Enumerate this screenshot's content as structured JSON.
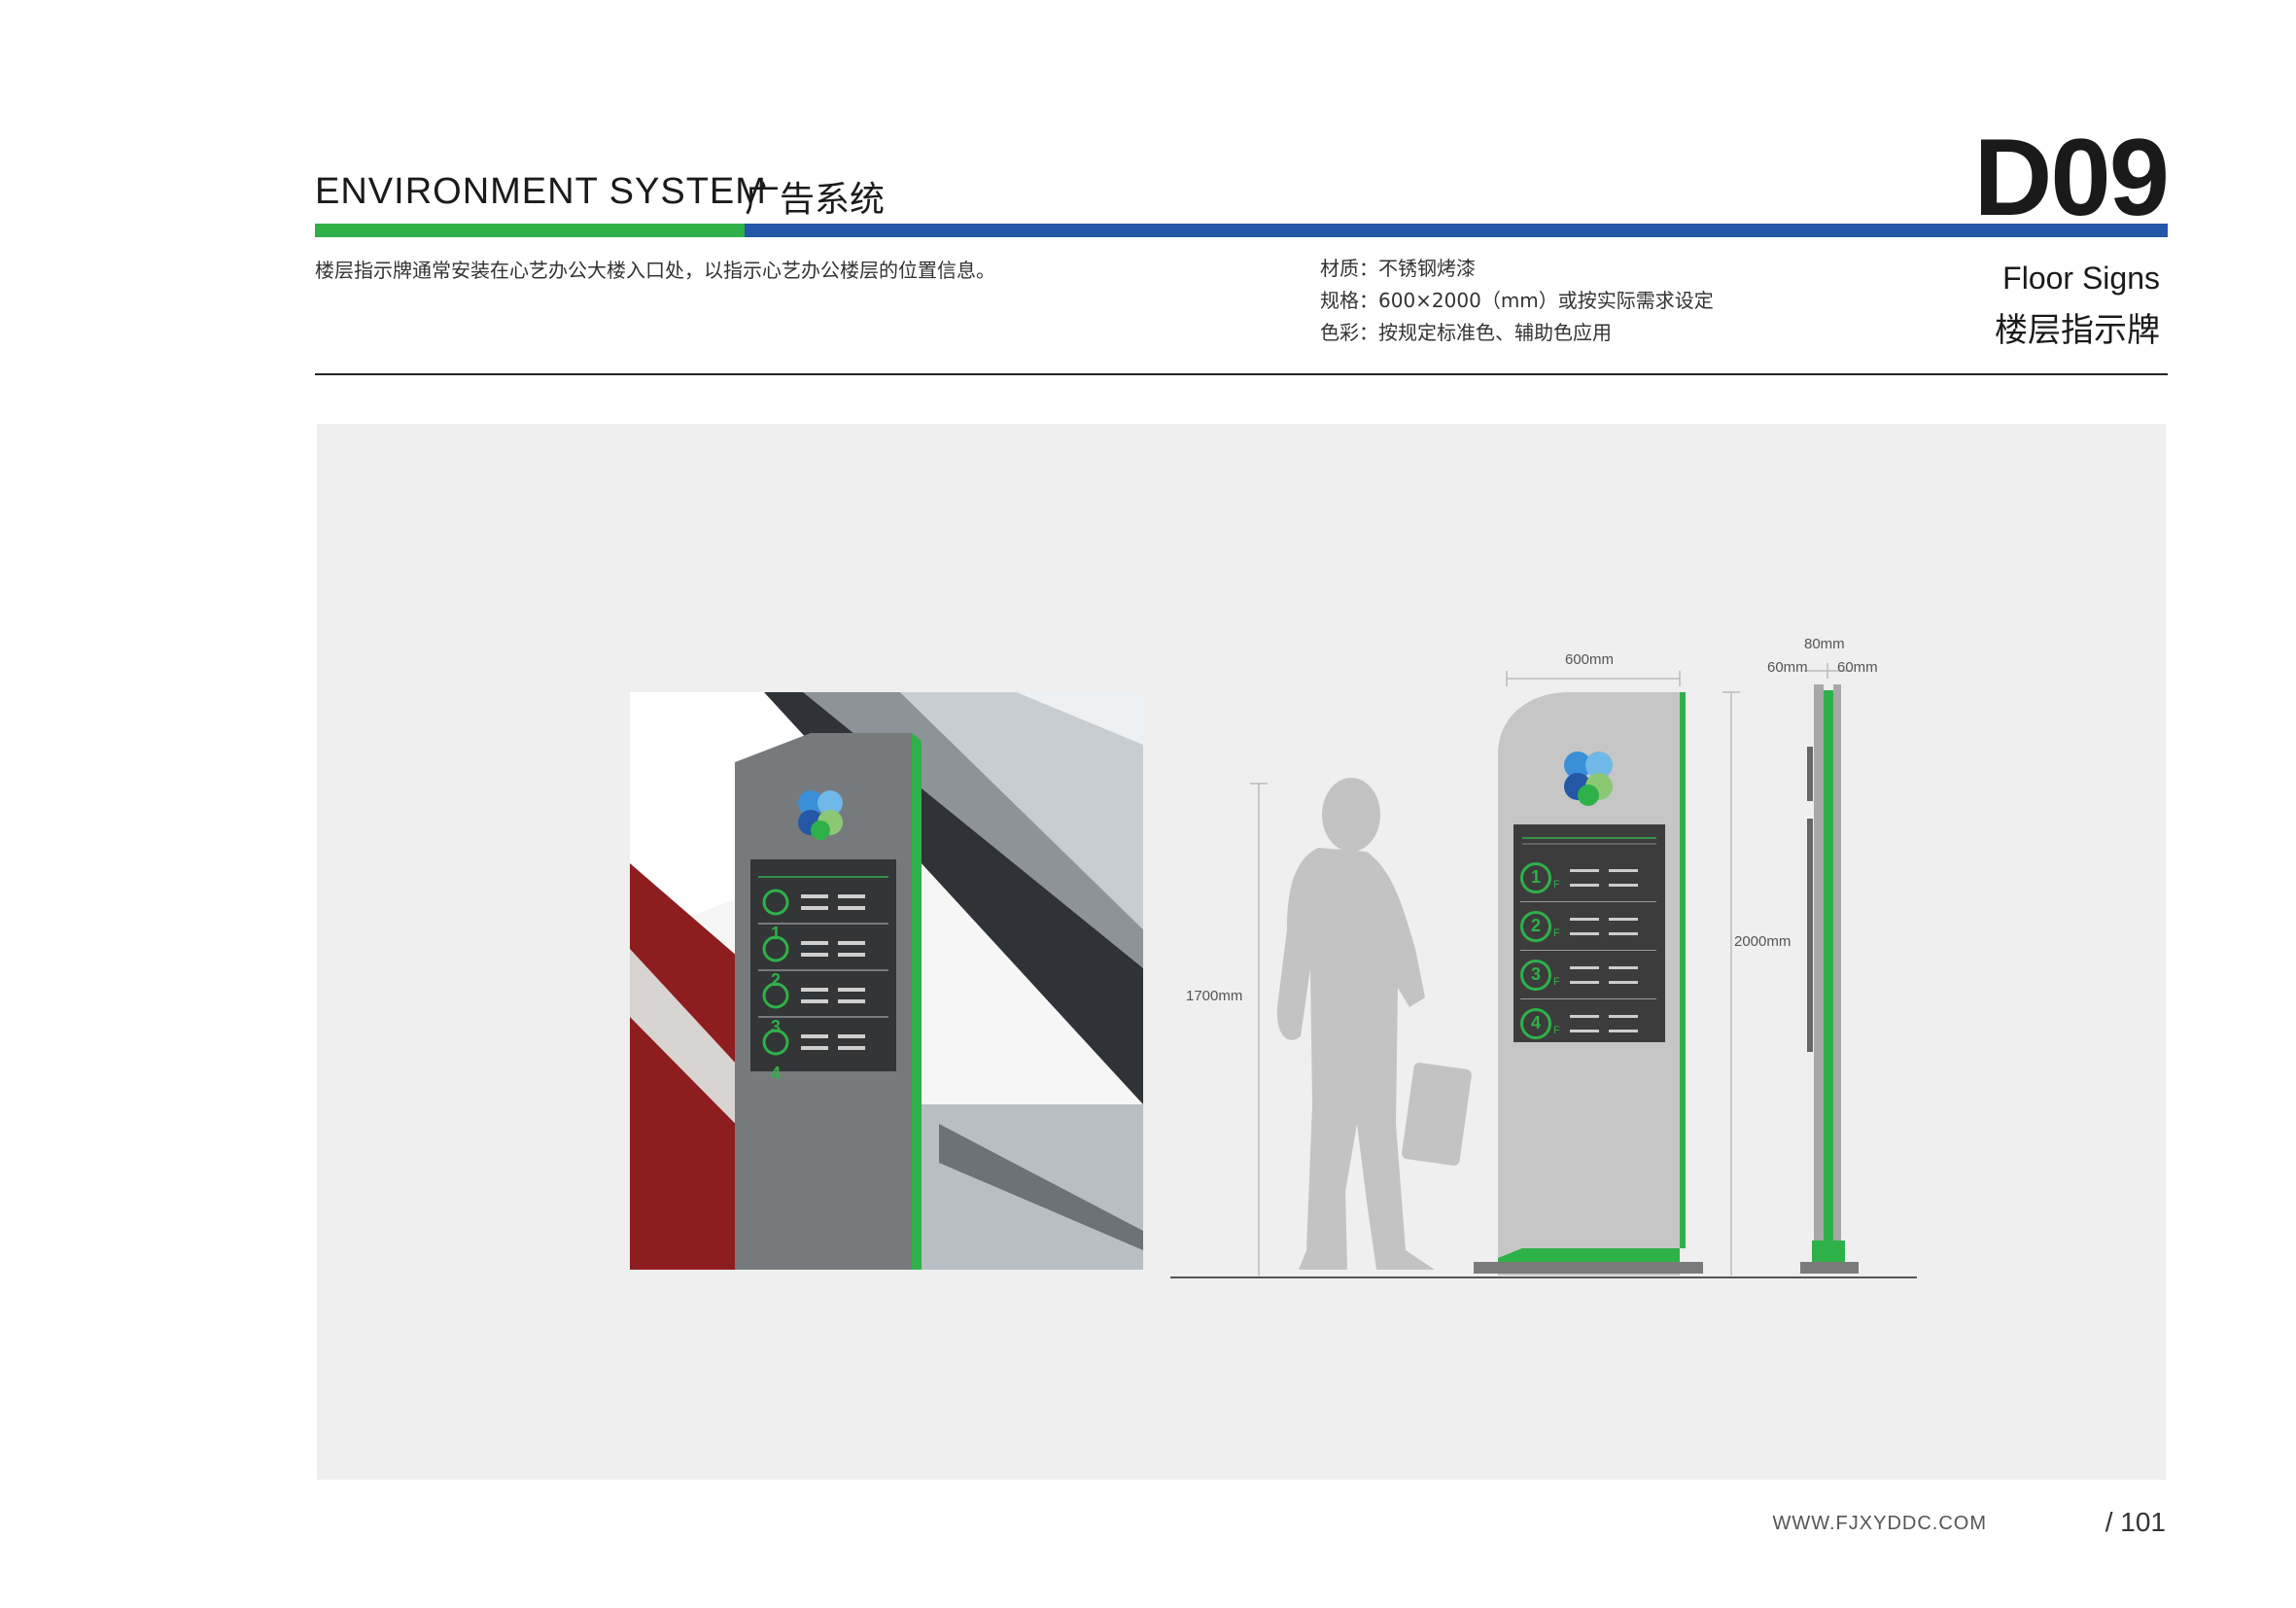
{
  "header": {
    "section_en": "ENVIRONMENT SYSTEM",
    "section_cn": "广告系统",
    "code": "D09"
  },
  "description": "楼层指示牌通常安装在心艺办公大楼入口处，以指示心艺办公楼层的位置信息。",
  "specs": {
    "material": "材质：不锈钢烤漆",
    "size": "规格：600×2000（mm）或按实际需求设定",
    "color": "色彩：按规定标准色、辅助色应用"
  },
  "title": {
    "en": "Floor Signs",
    "cn": "楼层指示牌"
  },
  "drawing": {
    "width_label": "600mm",
    "height_label": "2000mm",
    "person_label": "1700mm",
    "depth_label": "80mm",
    "side_left_label": "60mm",
    "side_right_label": "60mm",
    "floors": [
      "1",
      "2",
      "3",
      "4"
    ],
    "floor_suffix": "F"
  },
  "colors": {
    "green": "#2fb14a",
    "blue": "#2457a6",
    "panel": "#eeefee",
    "sign_dark": "#3c3c3c"
  },
  "footer": {
    "url": "WWW.FJXYDDC.COM",
    "page": "/ 101"
  }
}
